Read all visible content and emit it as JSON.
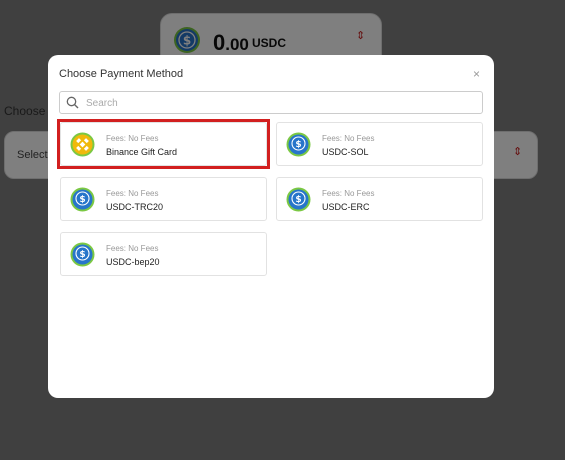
{
  "background": {
    "amount": {
      "whole": "0",
      "decimals": ".00",
      "unit": "USDC"
    },
    "amount_caret": "⇕",
    "label": "Choose P",
    "select_placeholder": "Select",
    "select_caret": "⇕"
  },
  "modal": {
    "title": "Choose Payment Method",
    "close_glyph": "×",
    "search": {
      "placeholder": "Search",
      "value": ""
    },
    "methods": [
      {
        "fees": "Fees: No Fees",
        "name": "Binance Gift Card",
        "icon": "binance-icon",
        "selected": true
      },
      {
        "fees": "Fees: No Fees",
        "name": "USDC-SOL",
        "icon": "usdc-sol-icon"
      },
      {
        "fees": "Fees: No Fees",
        "name": "USDC-TRC20",
        "icon": "usdc-trc20-icon"
      },
      {
        "fees": "Fees: No Fees",
        "name": "USDC-ERC",
        "icon": "usdc-erc-icon"
      },
      {
        "fees": "Fees: No Fees",
        "name": "USDC-bep20",
        "icon": "usdc-bep20-icon"
      }
    ]
  },
  "colors": {
    "usdc_blue": "#2775CA",
    "usdc_ring": "#7bc843",
    "binance_yellow": "#F0B90B",
    "highlight": "#d21f1f"
  }
}
